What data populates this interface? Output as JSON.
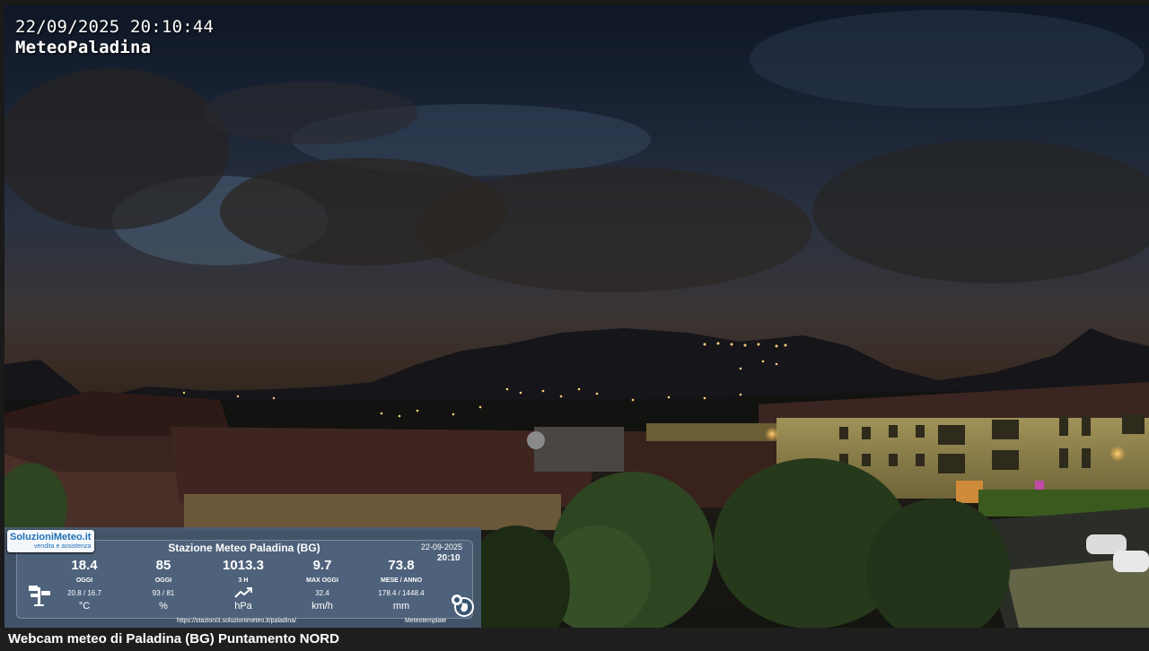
{
  "overlay": {
    "timestamp": "22/09/2025 20:10:44",
    "station_name": "MeteoPaladina"
  },
  "caption": "Webcam meteo di Paladina (BG) Puntamento NORD",
  "panel": {
    "logo_text": "SoluzioniMeteo.it",
    "logo_sub": "vendita e assistenza",
    "title": "Stazione Meteo Paladina (BG)",
    "date": "22-09-2025",
    "time": "20:10",
    "metrics": [
      {
        "value": "18.4",
        "label": "OGGI",
        "sub": "20.8 / 16.7",
        "unit": "°C"
      },
      {
        "value": "85",
        "label": "OGGI",
        "sub": "93 / 81",
        "unit": "%"
      },
      {
        "value": "1013.3",
        "label": "3 H",
        "sub": "",
        "unit": "hPa"
      },
      {
        "value": "9.7",
        "label": "MAX OGGI",
        "sub": "32.4",
        "unit": "km/h"
      },
      {
        "value": "73.8",
        "label": "MESE / ANNO",
        "sub": "178.4 / 1448.4",
        "unit": "mm"
      }
    ],
    "url": "https://stazioni3.soluzionimeteo.it/paladina/",
    "template": "Meteotemplate",
    "icons": [
      "weather-station-icon",
      "trend-up-icon",
      "globe-icon"
    ]
  }
}
